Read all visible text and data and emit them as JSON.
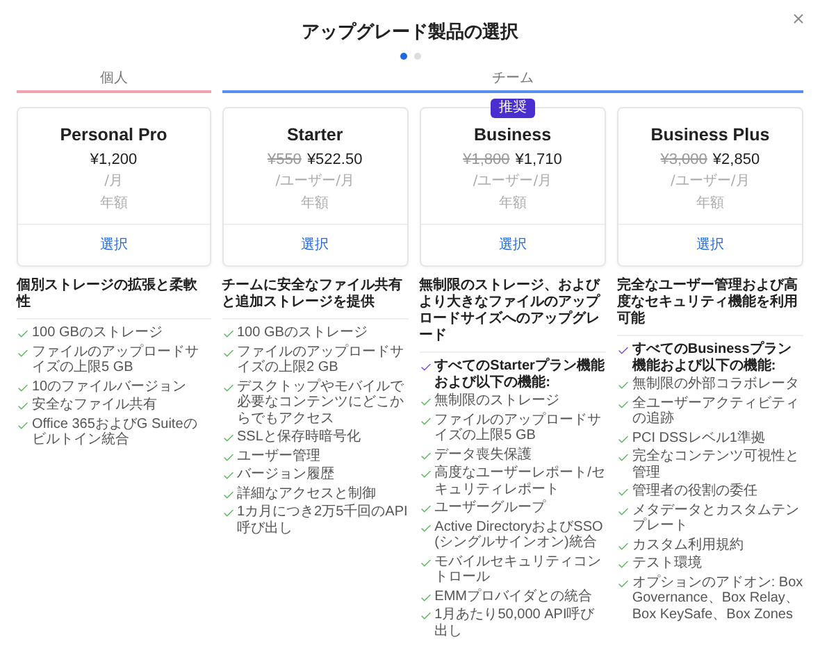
{
  "title": "アップグレード製品の選択",
  "pager": [
    {
      "selected": true
    },
    {
      "selected": false
    }
  ],
  "groups": [
    {
      "label": "個人",
      "color": "#f0a3ad",
      "plans": [
        {
          "name": "Personal Pro",
          "price": "¥1,200",
          "unit": "/月",
          "billing": "年額",
          "select": "選択",
          "summary": "個別ストレージの拡張と柔軟性",
          "features": [
            {
              "kind": "standard",
              "text": "100 GBのストレージ"
            },
            {
              "kind": "standard",
              "text": "ファイルのアップロードサイズの上限5 GB"
            },
            {
              "kind": "standard",
              "text": "10のファイルバージョン"
            },
            {
              "kind": "standard",
              "text": "安全なファイル共有"
            },
            {
              "kind": "standard",
              "text": "Office 365およびG Suiteのビルトイン統合"
            }
          ]
        }
      ]
    },
    {
      "label": "チーム",
      "color": "#5b8def",
      "plans": [
        {
          "name": "Starter",
          "original_price": "¥550",
          "price": "¥522.50",
          "unit": "/ユーザー/月",
          "billing": "年額",
          "select": "選択",
          "summary": "チームに安全なファイル共有と追加ストレージを提供",
          "features": [
            {
              "kind": "standard",
              "text": "100 GBのストレージ"
            },
            {
              "kind": "standard",
              "text": "ファイルのアップロードサイズの上限2 GB"
            },
            {
              "kind": "standard",
              "text": "デスクトップやモバイルで必要なコンテンツにどこからでもアクセス"
            },
            {
              "kind": "standard",
              "text": "SSLと保存時暗号化"
            },
            {
              "kind": "standard",
              "text": "ユーザー管理"
            },
            {
              "kind": "standard",
              "text": "バージョン履歴"
            },
            {
              "kind": "standard",
              "text": "詳細なアクセスと制御"
            },
            {
              "kind": "standard",
              "text": "1カ月につき2万5千回のAPI呼び出し"
            }
          ]
        },
        {
          "name": "Business",
          "badge": "推奨",
          "original_price": "¥1,800",
          "price": "¥1,710",
          "unit": "/ユーザー/月",
          "billing": "年額",
          "select": "選択",
          "summary": "無制限のストレージ、およびより大きなファイルのアップロードサイズへのアップグレード",
          "features": [
            {
              "kind": "highlight",
              "text": "すべてのStarterプラン機能および以下の機能:"
            },
            {
              "kind": "standard",
              "text": "無制限のストレージ"
            },
            {
              "kind": "standard",
              "text": "ファイルのアップロードサイズの上限5 GB"
            },
            {
              "kind": "standard",
              "text": "データ喪失保護"
            },
            {
              "kind": "standard",
              "text": "高度なユーザーレポート/セキュリティレポート"
            },
            {
              "kind": "standard",
              "text": "ユーザーグループ"
            },
            {
              "kind": "standard",
              "text": "Active DirectoryおよびSSO(シングルサインオン)統合"
            },
            {
              "kind": "standard",
              "text": "モバイルセキュリティコントロール"
            },
            {
              "kind": "standard",
              "text": "EMMプロバイダとの統合"
            },
            {
              "kind": "standard",
              "text": "1月あたり50,000 API呼び出し"
            }
          ]
        },
        {
          "name": "Business Plus",
          "original_price": "¥3,000",
          "price": "¥2,850",
          "unit": "/ユーザー/月",
          "billing": "年額",
          "select": "選択",
          "summary": "完全なユーザー管理および高度なセキュリティ機能を利用可能",
          "features": [
            {
              "kind": "highlight",
              "text": "すべてのBusinessプラン機能および以下の機能:"
            },
            {
              "kind": "standard",
              "text": "無制限の外部コラボレータ"
            },
            {
              "kind": "standard",
              "text": "全ユーザーアクティビティの追跡"
            },
            {
              "kind": "standard",
              "text": "PCI DSSレベル1準拠"
            },
            {
              "kind": "standard",
              "text": "完全なコンテンツ可視性と管理"
            },
            {
              "kind": "standard",
              "text": "管理者の役割の委任"
            },
            {
              "kind": "standard",
              "text": "メタデータとカスタムテンプレート"
            },
            {
              "kind": "standard",
              "text": "カスタム利用規約"
            },
            {
              "kind": "standard",
              "text": "テスト環境"
            },
            {
              "kind": "standard",
              "text": "オプションのアドオン: Box Governance、Box Relay、Box KeySafe、Box Zones"
            }
          ]
        }
      ]
    }
  ]
}
